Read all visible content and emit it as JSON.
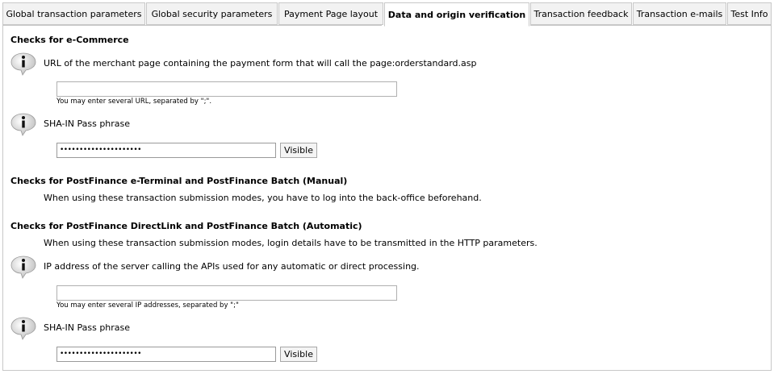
{
  "tabs": [
    {
      "label": "Global transaction parameters"
    },
    {
      "label": "Global security parameters"
    },
    {
      "label": "Payment Page layout"
    },
    {
      "label": "Data and origin verification"
    },
    {
      "label": "Transaction feedback"
    },
    {
      "label": "Transaction e-mails"
    },
    {
      "label": "Test Info"
    }
  ],
  "active_tab": "Data and origin verification",
  "ecommerce": {
    "heading": "Checks for e-Commerce",
    "url_label": "URL of the merchant page containing the payment form that will call the page:orderstandard.asp",
    "url_value": "",
    "url_hint": "You may enter several URL, separated by \";\".",
    "sha_label": "SHA-IN Pass phrase",
    "sha_value": "•••••••••••••••••••••",
    "visible_label": "Visible"
  },
  "eterminal": {
    "heading": "Checks for PostFinance e-Terminal and PostFinance Batch (Manual)",
    "description": "When using these transaction submission modes, you have to log into the back-office beforehand."
  },
  "directlink": {
    "heading": "Checks for PostFinance DirectLink and PostFinance Batch (Automatic)",
    "description": "When using these transaction submission modes, login details have to be transmitted in the HTTP parameters.",
    "ip_label": "IP address of the server calling the APIs used for any automatic or direct processing.",
    "ip_value": "",
    "ip_hint": "You may enter several IP addresses, separated by \";\"",
    "sha_label": "SHA-IN Pass phrase",
    "sha_value": "•••••••••••••••••••••",
    "visible_label": "Visible"
  },
  "icons": {
    "info": "info-speech-bubble-icon"
  }
}
